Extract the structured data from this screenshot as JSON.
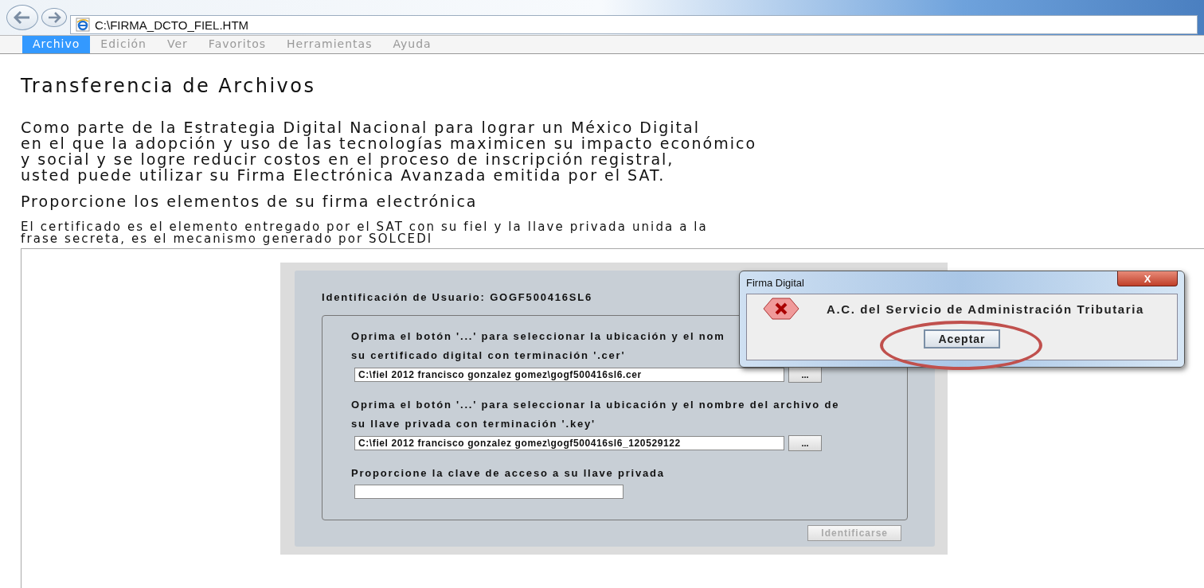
{
  "browser": {
    "address": "C:\\FIRMA_DCTO_FIEL.HTM"
  },
  "menu": [
    {
      "label": "Archivo",
      "selected": true
    },
    {
      "label": "Edición",
      "selected": false
    },
    {
      "label": "Ver",
      "selected": false
    },
    {
      "label": "Favoritos",
      "selected": false
    },
    {
      "label": "Herramientas",
      "selected": false
    },
    {
      "label": "Ayuda",
      "selected": false
    }
  ],
  "page": {
    "title": "Transferencia de Archivos",
    "intro": [
      "Como parte de la Estrategia Digital Nacional para lograr un México Digital",
      "en el que la adopción y uso de las tecnologías maximicen su impacto económico",
      "y social y se logre reducir costos en el proceso de inscripción registral,",
      "usted puede utilizar su Firma Electrónica Avanzada emitida por el SAT."
    ],
    "subtitle": "Proporcione los elementos de su firma electrónica",
    "note": [
      "El certificado es el elemento entregado por el SAT con su fiel y la llave privada unida a la",
      "frase secreta, es el mecanismo generado por SOLCEDI"
    ]
  },
  "applet": {
    "user_id": "Identificación de Usuario: GOGF500416SL6",
    "fields": [
      {
        "kind": "file",
        "label": [
          "Oprima el  botón '...' para seleccionar la ubicación y el nom",
          "su certificado digital con terminación '.cer'"
        ],
        "value": "C:\\fiel 2012 francisco gonzalez gomez\\gogf500416sl6.cer",
        "browse": "..."
      },
      {
        "kind": "file",
        "label": [
          "Oprima el  botón '...' para seleccionar la ubicación y el nombre del archivo de",
          "su llave privada con terminación '.key'"
        ],
        "value": "C:\\fiel 2012 francisco gonzalez gomez\\gogf500416sl6_120529122",
        "browse": "..."
      },
      {
        "kind": "password",
        "label": [
          "Proporcione la clave de acceso a su llave privada"
        ]
      }
    ],
    "submit": {
      "label": "Identificarse",
      "disabled": true
    }
  },
  "dialog": {
    "title": "Firma Digital",
    "close": "X",
    "message": "A.C. del Servicio de Administración Tributaria",
    "button": "Aceptar",
    "highlighted": true
  }
}
